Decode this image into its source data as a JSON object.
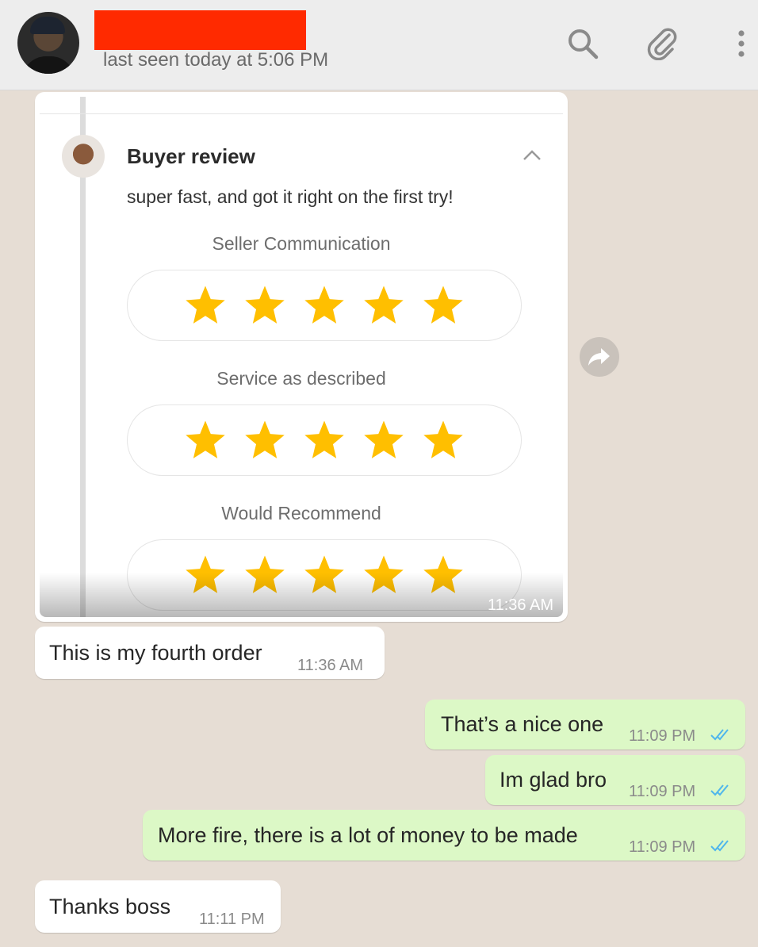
{
  "contact": {
    "status": "last seen today at 5:06 PM"
  },
  "header_icons": [
    "search-icon",
    "paperclip-icon",
    "more-vert-icon"
  ],
  "review_card": {
    "title": "Buyer review",
    "body": "super fast, and got it right on the first try!",
    "ratings": [
      {
        "label": "Seller Communication",
        "stars": 5
      },
      {
        "label": "Service as described",
        "stars": 5
      },
      {
        "label": "Would Recommend",
        "stars": 5
      }
    ],
    "time": "11:36 AM"
  },
  "messages": [
    {
      "text": "This is my fourth order",
      "time": "11:36 AM",
      "direction": "in"
    },
    {
      "text": "That’s a nice one",
      "time": "11:09 PM",
      "direction": "out",
      "read": true
    },
    {
      "text": "Im glad bro",
      "time": "11:09 PM",
      "direction": "out",
      "read": true
    },
    {
      "text": "More fire, there is a lot of money to be made",
      "time": "11:09 PM",
      "direction": "out",
      "read": true
    },
    {
      "text": "Thanks boss",
      "time": "11:11 PM",
      "direction": "in"
    }
  ],
  "colors": {
    "chat_bg": "#e6ddd4",
    "outgoing_bubble": "#dcf8c6",
    "incoming_bubble": "#ffffff",
    "star": "#ffbf00",
    "read_ticks": "#4fb6ec",
    "redaction": "#ff2a00"
  }
}
